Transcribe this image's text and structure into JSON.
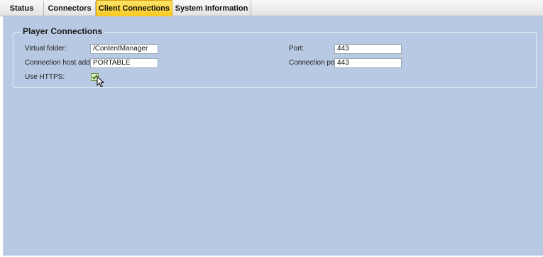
{
  "tabs": [
    {
      "label": "Status"
    },
    {
      "label": "Connectors"
    },
    {
      "label": "Client Connections"
    },
    {
      "label": "System Information"
    }
  ],
  "active_tab": "Client Connections",
  "group": {
    "title": "Player Connections",
    "virtual_folder_label": "Virtual folder:",
    "virtual_folder_value": "/ContentManager",
    "host_label": "Connection host address:",
    "host_value": "PORTABLE",
    "https_label": "Use HTTPS:",
    "https_checked": true,
    "port_label": "Port:",
    "port_value": "443",
    "conn_port_label": "Connection port:",
    "conn_port_value": "443"
  },
  "colors": {
    "active_tab": "#f8c81c",
    "panel_background": "#b8cae3"
  },
  "icons": {
    "checkbox": "check-icon",
    "pointer": "mouse-cursor-icon"
  }
}
